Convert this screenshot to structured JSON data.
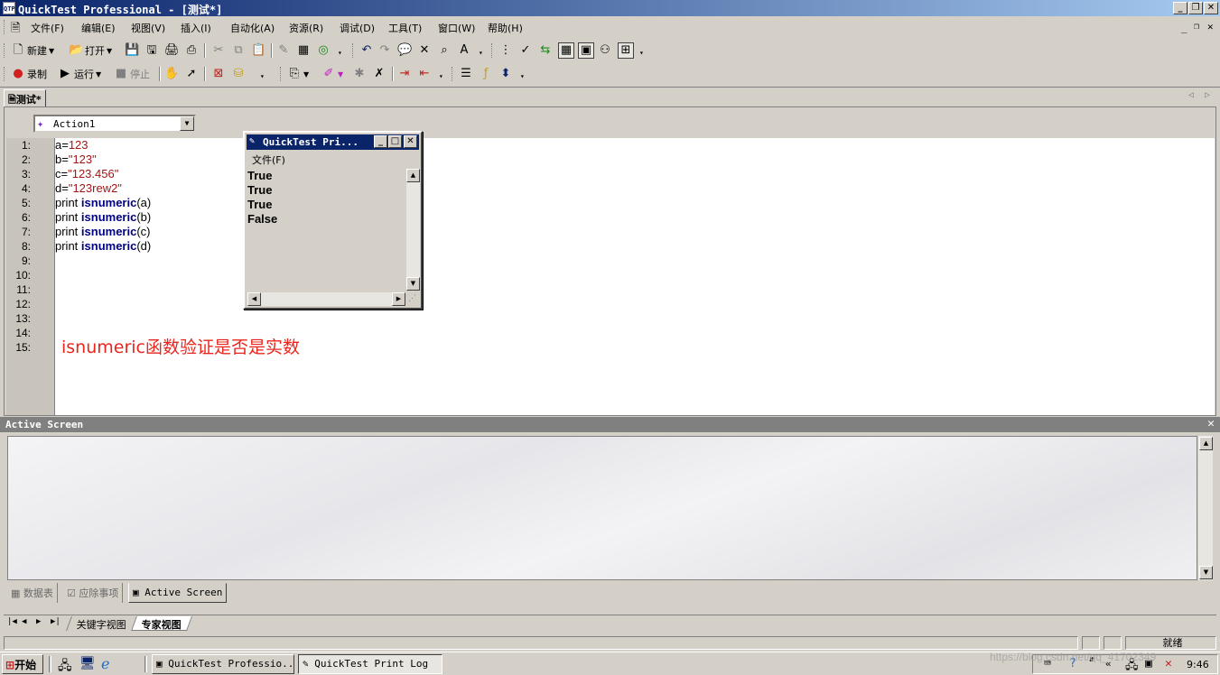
{
  "window": {
    "title": "QuickTest Professional - [测试*]",
    "app_icon": "QTP",
    "doc_tab": "测试*"
  },
  "menu": [
    "文件(F)",
    "编辑(E)",
    "视图(V)",
    "插入(I)",
    "自动化(A)",
    "资源(R)",
    "调试(D)",
    "工具(T)",
    "窗口(W)",
    "帮助(H)"
  ],
  "toolbar": {
    "new_label": "新建",
    "open_label": "打开",
    "record_label": "录制",
    "run_label": "运行",
    "stop_label": "停止"
  },
  "editor": {
    "action_selected": "Action1",
    "line_numbers": [
      "1:",
      "2:",
      "3:",
      "4:",
      "5:",
      "6:",
      "7:",
      "8:",
      "9:",
      "10:",
      "11:",
      "12:",
      "13:",
      "14:",
      "15:"
    ],
    "code": {
      "l1_var": "a",
      "l1_eq": "=",
      "l1_val": "123",
      "l2_var": "b",
      "l2_eq": "=",
      "l2_val": "\"123\"",
      "l3_var": "c",
      "l3_eq": "=",
      "l3_val": "\"123.456\"",
      "l4_var": "d",
      "l4_eq": "=",
      "l4_val": "\"123rew2\"",
      "print_kw": "print ",
      "fn_name": "isnumeric",
      "args": [
        "(a)",
        "(b)",
        "(c)",
        "(d)"
      ]
    },
    "annotation": "isnumeric函数验证是否是实数"
  },
  "print_log": {
    "title": "QuickTest Pri...",
    "menu_file": "文件(F)",
    "lines": [
      "True",
      "True",
      "True",
      "False"
    ]
  },
  "active_screen": {
    "title": "Active Screen"
  },
  "bottom_tabs": [
    "数据表",
    "应除事项",
    "Active Screen"
  ],
  "view_tabs": [
    "关键字视图",
    "专家视图"
  ],
  "status": {
    "text": "就绪"
  },
  "taskbar": {
    "start": "开始",
    "tasks": [
      "QuickTest Professio...",
      "QuickTest Print Log"
    ],
    "time": "9:46",
    "watermark": "https://blog.csdn.net/qq_41702349"
  },
  "colors": {
    "title_bar": "#0a246a",
    "string": "#a31515",
    "function": "#000080",
    "annotation": "#e8261e"
  }
}
